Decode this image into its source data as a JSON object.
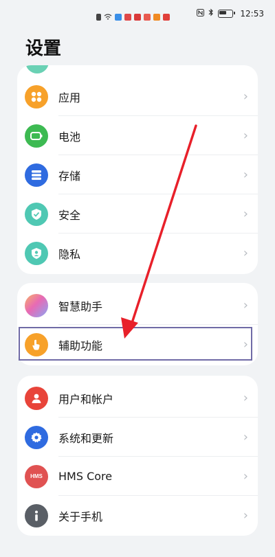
{
  "status_bar": {
    "time": "12:53"
  },
  "page": {
    "title": "设置"
  },
  "groups": [
    {
      "items": [
        {
          "label": "应用",
          "icon": "apps-icon",
          "color": "#f7a12a"
        },
        {
          "label": "电池",
          "icon": "battery-icon",
          "color": "#3dba52"
        },
        {
          "label": "存储",
          "icon": "storage-icon",
          "color": "#2f6be0"
        },
        {
          "label": "安全",
          "icon": "shield-icon",
          "color": "#4fc8b3"
        },
        {
          "label": "隐私",
          "icon": "privacy-icon",
          "color": "#4fc8b3"
        }
      ]
    },
    {
      "items": [
        {
          "label": "智慧助手",
          "icon": "smart-assistant-icon",
          "color": "#c88de4"
        },
        {
          "label": "辅助功能",
          "icon": "accessibility-icon",
          "color": "#f7a12a"
        }
      ]
    },
    {
      "items": [
        {
          "label": "用户和帐户",
          "icon": "user-account-icon",
          "color": "#e8443a"
        },
        {
          "label": "系统和更新",
          "icon": "system-update-icon",
          "color": "#2f6be0"
        },
        {
          "label": "HMS Core",
          "icon": "hms-core-icon",
          "color": "#e05252",
          "icon_text": "HMS"
        },
        {
          "label": "关于手机",
          "icon": "about-phone-icon",
          "color": "#5a5f66"
        }
      ]
    }
  ],
  "colors": {
    "background": "#f1f3f5",
    "card": "#ffffff",
    "arrow": "#e8202a",
    "highlight_border": "#6f6aa6",
    "chevron": "#b8bcc2"
  }
}
